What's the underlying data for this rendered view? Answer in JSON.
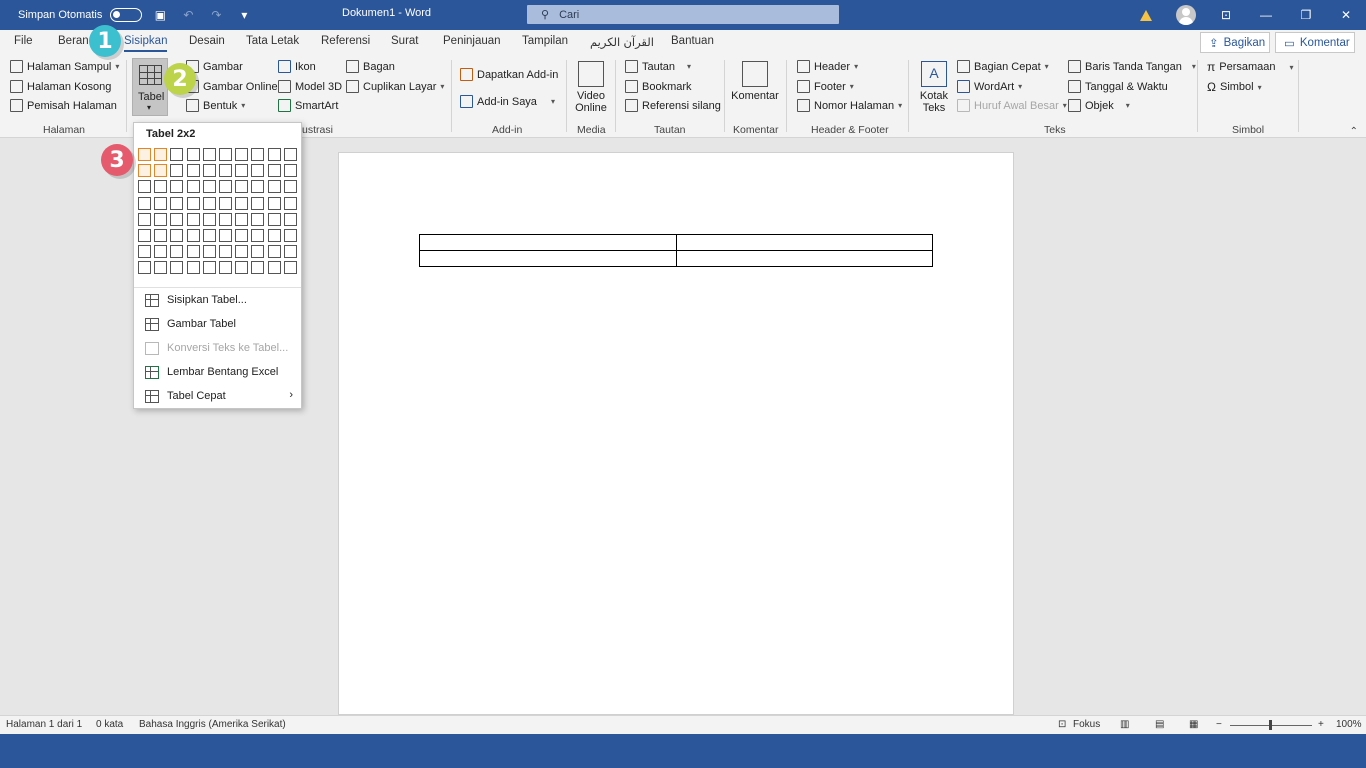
{
  "titlebar": {
    "autosave_label": "Simpan Otomatis",
    "doc_title": "Dokumen1  -  Word",
    "search_placeholder": "Cari"
  },
  "tabs": [
    {
      "label": "File"
    },
    {
      "label": "Beranda"
    },
    {
      "label": "Sisipkan",
      "active": true
    },
    {
      "label": "Desain"
    },
    {
      "label": "Tata Letak"
    },
    {
      "label": "Referensi"
    },
    {
      "label": "Surat"
    },
    {
      "label": "Peninjauan"
    },
    {
      "label": "Tampilan"
    },
    {
      "label": "القرآن الكريم"
    },
    {
      "label": "Bantuan"
    }
  ],
  "share_label": "Bagikan",
  "comment_label": "Komentar",
  "ribbon": {
    "halaman": {
      "items": [
        "Halaman Sampul",
        "Halaman Kosong",
        "Pemisah Halaman"
      ],
      "group": "Halaman"
    },
    "tabel": {
      "label": "Tabel"
    },
    "ilustrasi": {
      "items": [
        "Gambar",
        "Gambar Online",
        "Bentuk",
        "Ikon",
        "Model 3D",
        "SmartArt",
        "Bagan",
        "Cuplikan Layar"
      ],
      "group": "Ilustrasi",
      "group_visible": "ustrasi"
    },
    "addin": {
      "items": [
        "Dapatkan Add-in",
        "Add-in Saya"
      ],
      "group": "Add-in"
    },
    "media": {
      "label_line1": "Video",
      "label_line2": "Online",
      "group": "Media"
    },
    "tautan": {
      "items": [
        "Tautan",
        "Bookmark",
        "Referensi silang"
      ],
      "group": "Tautan"
    },
    "komentar": {
      "label": "Komentar",
      "group": "Komentar"
    },
    "header_footer": {
      "items": [
        "Header",
        "Footer",
        "Nomor Halaman"
      ],
      "group": "Header & Footer"
    },
    "teks": {
      "big_line1": "Kotak",
      "big_line2": "Teks",
      "items": [
        "Bagian Cepat",
        "WordArt",
        "Huruf Awal Besar",
        "Baris Tanda Tangan",
        "Tanggal & Waktu",
        "Objek"
      ],
      "group": "Teks"
    },
    "simbol": {
      "items": [
        "Persamaan",
        "Simbol"
      ],
      "group": "Simbol"
    }
  },
  "dropdown": {
    "title": "Tabel 2x2",
    "grid_cols": 10,
    "grid_rows": 8,
    "selected_cols": 2,
    "selected_rows": 2,
    "items": [
      {
        "label": "Sisipkan Tabel...",
        "disabled": false
      },
      {
        "label": "Gambar Tabel",
        "disabled": false
      },
      {
        "label": "Konversi Teks ke Tabel...",
        "disabled": true
      },
      {
        "label": "Lembar Bentang Excel",
        "disabled": false
      },
      {
        "label": "Tabel Cepat",
        "disabled": false,
        "submenu": true
      }
    ]
  },
  "badges": [
    "1",
    "2",
    "3"
  ],
  "statusbar": {
    "page": "Halaman 1 dari 1",
    "words": "0 kata",
    "language": "Bahasa Inggris (Amerika Serikat)",
    "focus": "Fokus",
    "zoom": "100%",
    "zoom_minus": "−",
    "zoom_plus": "+"
  },
  "colors": {
    "accent": "#2b579a",
    "badge1": "#3cc0d0",
    "badge2": "#bcd34a",
    "badge3": "#e55a6c",
    "grid_highlight": "#e3862a"
  }
}
